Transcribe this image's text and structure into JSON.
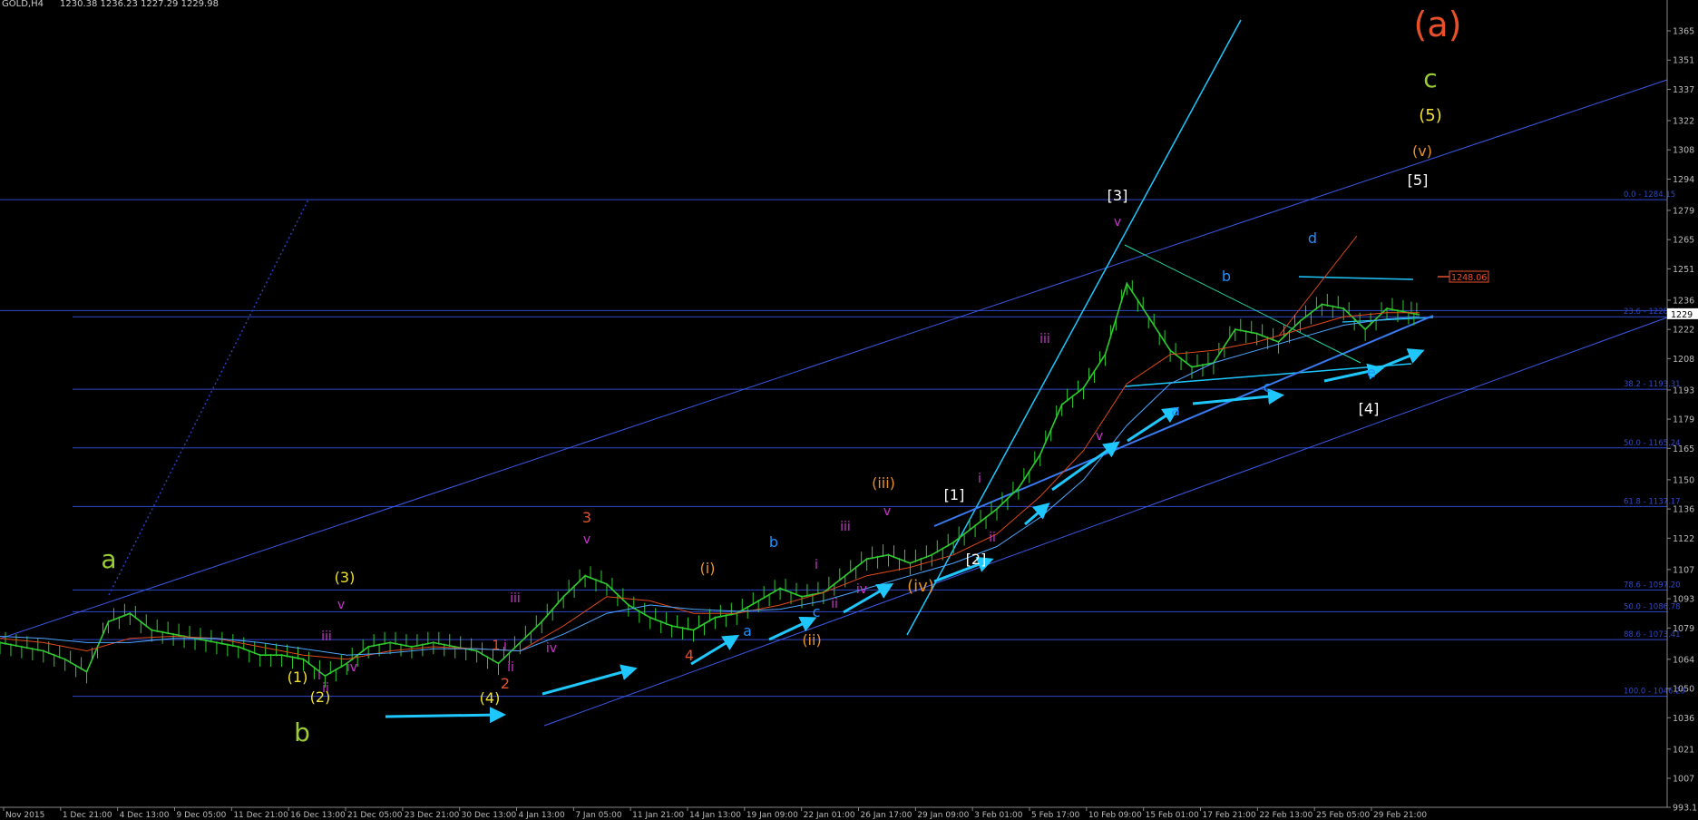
{
  "header": {
    "symbol": "GOLD,H4",
    "ohlc": "1230.38 1236.23 1227.29 1229.98"
  },
  "price_label": {
    "text": "1248.06",
    "price": 1248.06
  },
  "chart_data": {
    "type": "line",
    "title": "GOLD,H4",
    "ylim": [
      993.1,
      1366.0
    ],
    "y_ticks": [
      1365,
      1351,
      1337,
      1322,
      1308,
      1294,
      1279,
      1265,
      1251,
      1236,
      1222,
      1208,
      1193,
      1179,
      1165,
      1150,
      1136,
      1122,
      1107,
      1093,
      1079,
      1064,
      1050,
      1036,
      1021,
      1007,
      "993.1"
    ],
    "current_price": "1229",
    "x_ticks": [
      "Nov 2015",
      "1 Dec 21:00",
      "4 Dec 13:00",
      "9 Dec 05:00",
      "11 Dec 21:00",
      "16 Dec 13:00",
      "21 Dec 05:00",
      "23 Dec 21:00",
      "30 Dec 13:00",
      "4 Jan 13:00",
      "7 Jan 05:00",
      "11 Jan 21:00",
      "14 Jan 13:00",
      "19 Jan 09:00",
      "22 Jan 01:00",
      "26 Jan 17:00",
      "29 Jan 09:00",
      "3 Feb 01:00",
      "5 Feb 17:00",
      "10 Feb 09:00",
      "15 Feb 01:00",
      "17 Feb 21:00",
      "22 Feb 13:00",
      "25 Feb 05:00",
      "29 Feb 21:00"
    ],
    "fib_levels": [
      {
        "label": "0.0 - 1284.15",
        "price": 1284.15
      },
      {
        "label": "23.6 - 1228.04",
        "price": 1228.04
      },
      {
        "label": "38.2 - 1193.31",
        "price": 1193.31
      },
      {
        "label": "50.0 - 1165.24",
        "price": 1165.24
      },
      {
        "label": "61.8 - 1137.17",
        "price": 1137.17
      },
      {
        "label": "78.6 - 1097.20",
        "price": 1097.2
      },
      {
        "label": "50.0 - 1086.78",
        "price": 1086.78
      },
      {
        "label": "88.6 - 1073.41",
        "price": 1073.41
      },
      {
        "label": "100.0 - 1046.29",
        "price": 1046.29
      }
    ],
    "series": [
      {
        "color": "#2ecc2e",
        "points": [
          [
            0,
            1072
          ],
          [
            20,
            1070
          ],
          [
            40,
            1068
          ],
          [
            60,
            1064
          ],
          [
            80,
            1058
          ],
          [
            100,
            1082
          ],
          [
            120,
            1086
          ],
          [
            140,
            1078
          ],
          [
            160,
            1076
          ],
          [
            180,
            1074
          ],
          [
            200,
            1072
          ],
          [
            220,
            1070
          ],
          [
            240,
            1066
          ],
          [
            260,
            1066
          ],
          [
            280,
            1064
          ],
          [
            300,
            1056
          ],
          [
            320,
            1062
          ],
          [
            340,
            1070
          ],
          [
            360,
            1072
          ],
          [
            380,
            1070
          ],
          [
            400,
            1072
          ],
          [
            420,
            1070
          ],
          [
            440,
            1068
          ],
          [
            460,
            1062
          ],
          [
            480,
            1072
          ],
          [
            500,
            1082
          ],
          [
            520,
            1094
          ],
          [
            540,
            1104
          ],
          [
            560,
            1100
          ],
          [
            580,
            1090
          ],
          [
            600,
            1084
          ],
          [
            620,
            1080
          ],
          [
            640,
            1078
          ],
          [
            660,
            1084
          ],
          [
            680,
            1086
          ],
          [
            700,
            1092
          ],
          [
            720,
            1098
          ],
          [
            740,
            1094
          ],
          [
            760,
            1096
          ],
          [
            780,
            1104
          ],
          [
            800,
            1112
          ],
          [
            820,
            1114
          ],
          [
            840,
            1110
          ],
          [
            860,
            1114
          ],
          [
            880,
            1120
          ],
          [
            900,
            1128
          ],
          [
            920,
            1136
          ],
          [
            940,
            1146
          ],
          [
            960,
            1162
          ],
          [
            980,
            1186
          ],
          [
            1000,
            1194
          ],
          [
            1020,
            1210
          ],
          [
            1040,
            1244
          ],
          [
            1060,
            1228
          ],
          [
            1080,
            1212
          ],
          [
            1100,
            1204
          ],
          [
            1120,
            1206
          ],
          [
            1140,
            1222
          ],
          [
            1160,
            1220
          ],
          [
            1180,
            1216
          ],
          [
            1200,
            1226
          ],
          [
            1220,
            1234
          ],
          [
            1240,
            1232
          ],
          [
            1260,
            1222
          ],
          [
            1280,
            1232
          ],
          [
            1300,
            1230
          ],
          [
            1310,
            1229
          ]
        ]
      },
      {
        "color": "#e04a1a",
        "points": [
          [
            0,
            1074
          ],
          [
            40,
            1072
          ],
          [
            80,
            1068
          ],
          [
            120,
            1074
          ],
          [
            160,
            1075
          ],
          [
            200,
            1074
          ],
          [
            240,
            1070
          ],
          [
            280,
            1066
          ],
          [
            320,
            1064
          ],
          [
            360,
            1068
          ],
          [
            400,
            1070
          ],
          [
            440,
            1069
          ],
          [
            480,
            1068
          ],
          [
            520,
            1080
          ],
          [
            560,
            1094
          ],
          [
            600,
            1092
          ],
          [
            640,
            1086
          ],
          [
            680,
            1086
          ],
          [
            720,
            1090
          ],
          [
            760,
            1096
          ],
          [
            800,
            1104
          ],
          [
            840,
            1108
          ],
          [
            880,
            1114
          ],
          [
            920,
            1124
          ],
          [
            960,
            1142
          ],
          [
            1000,
            1164
          ],
          [
            1040,
            1196
          ],
          [
            1080,
            1210
          ],
          [
            1120,
            1212
          ],
          [
            1160,
            1216
          ],
          [
            1200,
            1222
          ],
          [
            1240,
            1228
          ],
          [
            1280,
            1230
          ],
          [
            1310,
            1230
          ]
        ]
      },
      {
        "color": "#4da6ff",
        "points": [
          [
            0,
            1075
          ],
          [
            40,
            1074
          ],
          [
            80,
            1072
          ],
          [
            120,
            1072
          ],
          [
            160,
            1074
          ],
          [
            200,
            1074
          ],
          [
            240,
            1072
          ],
          [
            280,
            1069
          ],
          [
            320,
            1066
          ],
          [
            360,
            1067
          ],
          [
            400,
            1069
          ],
          [
            440,
            1069
          ],
          [
            480,
            1068
          ],
          [
            520,
            1076
          ],
          [
            560,
            1086
          ],
          [
            600,
            1090
          ],
          [
            640,
            1088
          ],
          [
            680,
            1087
          ],
          [
            720,
            1088
          ],
          [
            760,
            1092
          ],
          [
            800,
            1098
          ],
          [
            840,
            1104
          ],
          [
            880,
            1110
          ],
          [
            920,
            1118
          ],
          [
            960,
            1132
          ],
          [
            1000,
            1150
          ],
          [
            1040,
            1176
          ],
          [
            1080,
            1196
          ],
          [
            1120,
            1206
          ],
          [
            1160,
            1212
          ],
          [
            1200,
            1218
          ],
          [
            1240,
            1224
          ],
          [
            1280,
            1227
          ],
          [
            1310,
            1228
          ]
        ]
      }
    ],
    "wave_labels": [
      {
        "text": "(a)",
        "color": "#e8502a"
      },
      {
        "text": "c",
        "color": "#9acd32"
      },
      {
        "text": "(5)",
        "color": "#f0e130"
      },
      {
        "text": "(v)",
        "color": "#e8912a"
      },
      {
        "text": "[5]",
        "color": "#ffffff"
      },
      {
        "text": "[3]",
        "color": "#ffffff"
      },
      {
        "text": "v",
        "color": "#cc33cc"
      },
      {
        "text": "iii",
        "color": "#cc33cc"
      },
      {
        "text": "v",
        "color": "#cc33cc"
      },
      {
        "text": "b",
        "color": "#1e90ff"
      },
      {
        "text": "d",
        "color": "#1e90ff"
      },
      {
        "text": "c",
        "color": "#1e90ff"
      },
      {
        "text": "e",
        "color": "#1e90ff"
      },
      {
        "text": "a",
        "color": "#1e90ff"
      },
      {
        "text": "[4]",
        "color": "#ffffff"
      },
      {
        "text": "i",
        "color": "#cc33cc"
      },
      {
        "text": "[1]",
        "color": "#ffffff"
      },
      {
        "text": "ii",
        "color": "#cc33cc"
      },
      {
        "text": "[2]",
        "color": "#ffffff"
      },
      {
        "text": "(iii)",
        "color": "#e8912a"
      },
      {
        "text": "v",
        "color": "#cc33cc"
      },
      {
        "text": "iii",
        "color": "#cc33cc"
      },
      {
        "text": "i",
        "color": "#cc33cc"
      },
      {
        "text": "iv",
        "color": "#cc33cc"
      },
      {
        "text": "(iv)",
        "color": "#e8912a"
      },
      {
        "text": "ii",
        "color": "#cc33cc"
      },
      {
        "text": "c",
        "color": "#1e90ff"
      },
      {
        "text": "b",
        "color": "#1e90ff"
      },
      {
        "text": "a",
        "color": "#1e90ff"
      },
      {
        "text": "(ii)",
        "color": "#e8912a"
      },
      {
        "text": "(i)",
        "color": "#e8912a"
      },
      {
        "text": "4",
        "color": "#e8502a"
      },
      {
        "text": "3",
        "color": "#e8502a"
      },
      {
        "text": "v",
        "color": "#cc33cc"
      },
      {
        "text": "iii",
        "color": "#cc33cc"
      },
      {
        "text": "iv",
        "color": "#cc33cc"
      },
      {
        "text": "1",
        "color": "#e8502a"
      },
      {
        "text": "i",
        "color": "#cc33cc"
      },
      {
        "text": "ii",
        "color": "#cc33cc"
      },
      {
        "text": "2",
        "color": "#e8502a"
      },
      {
        "text": "(4)",
        "color": "#f0e130"
      },
      {
        "text": "(3)",
        "color": "#f0e130"
      },
      {
        "text": "v",
        "color": "#cc33cc"
      },
      {
        "text": "iii",
        "color": "#cc33cc"
      },
      {
        "text": "iv",
        "color": "#cc33cc"
      },
      {
        "text": "i",
        "color": "#cc33cc"
      },
      {
        "text": "ii",
        "color": "#cc33cc"
      },
      {
        "text": "(1)",
        "color": "#f0e130"
      },
      {
        "text": "(2)",
        "color": "#f0e130"
      },
      {
        "text": "a",
        "color": "#9acd32"
      },
      {
        "text": "b",
        "color": "#9acd32"
      }
    ]
  },
  "colors": {
    "background": "#000000",
    "fib_line": "#3048c8",
    "trend_line": "#4466ee",
    "cyan": "#1ec8ff",
    "axis_text": "#bbbbbb"
  }
}
